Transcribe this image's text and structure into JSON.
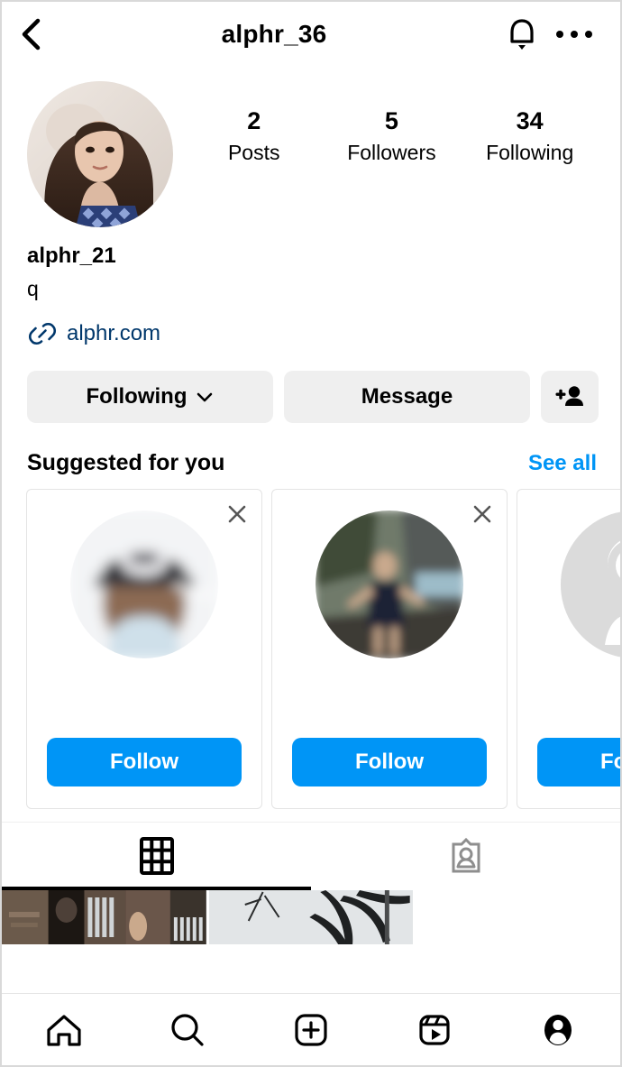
{
  "header": {
    "back_icon": "chevron-left-icon",
    "title": "alphr_36",
    "bell_icon": "bell-icon",
    "more_icon": "more-options-icon"
  },
  "profile": {
    "avatar_icon": "profile-avatar",
    "stats": [
      {
        "number": "2",
        "label": "Posts"
      },
      {
        "number": "5",
        "label": "Followers"
      },
      {
        "number": "34",
        "label": "Following"
      }
    ],
    "display_name": "alphr_21",
    "bio": "q",
    "link_icon": "link-chain-icon",
    "link_text": "alphr.com",
    "link_color": "#00376b"
  },
  "actions": {
    "following_label": "Following",
    "following_chevron": "chevron-down-icon",
    "message_label": "Message",
    "add_user_icon": "add-person-icon"
  },
  "suggested": {
    "title": "Suggested for you",
    "see_all_label": "See all",
    "see_all_color": "#0095f6",
    "dismiss_icon": "close-icon",
    "cards": [
      {
        "avatar_icon": "suggested-avatar-person-cap",
        "username": "",
        "subtitle": "",
        "follow_label": "Follow"
      },
      {
        "avatar_icon": "suggested-avatar-beach",
        "username": "",
        "subtitle": "",
        "follow_label": "Follow"
      },
      {
        "avatar_icon": "default-avatar-placeholder",
        "username": "",
        "subtitle": "",
        "follow_label": "Follow"
      }
    ],
    "follow_button_color": "#0095f6"
  },
  "tabs": [
    {
      "icon": "grid-icon",
      "active": true
    },
    {
      "icon": "tagged-icon",
      "active": false
    }
  ],
  "posts": [
    {
      "thumbnail": "post-building-dark"
    },
    {
      "thumbnail": "post-palm-sky"
    }
  ],
  "bottom_nav": [
    {
      "icon": "home-icon",
      "active": false
    },
    {
      "icon": "search-icon",
      "active": false
    },
    {
      "icon": "create-icon",
      "active": false
    },
    {
      "icon": "reels-icon",
      "active": false
    },
    {
      "icon": "profile-icon",
      "active": true
    }
  ]
}
